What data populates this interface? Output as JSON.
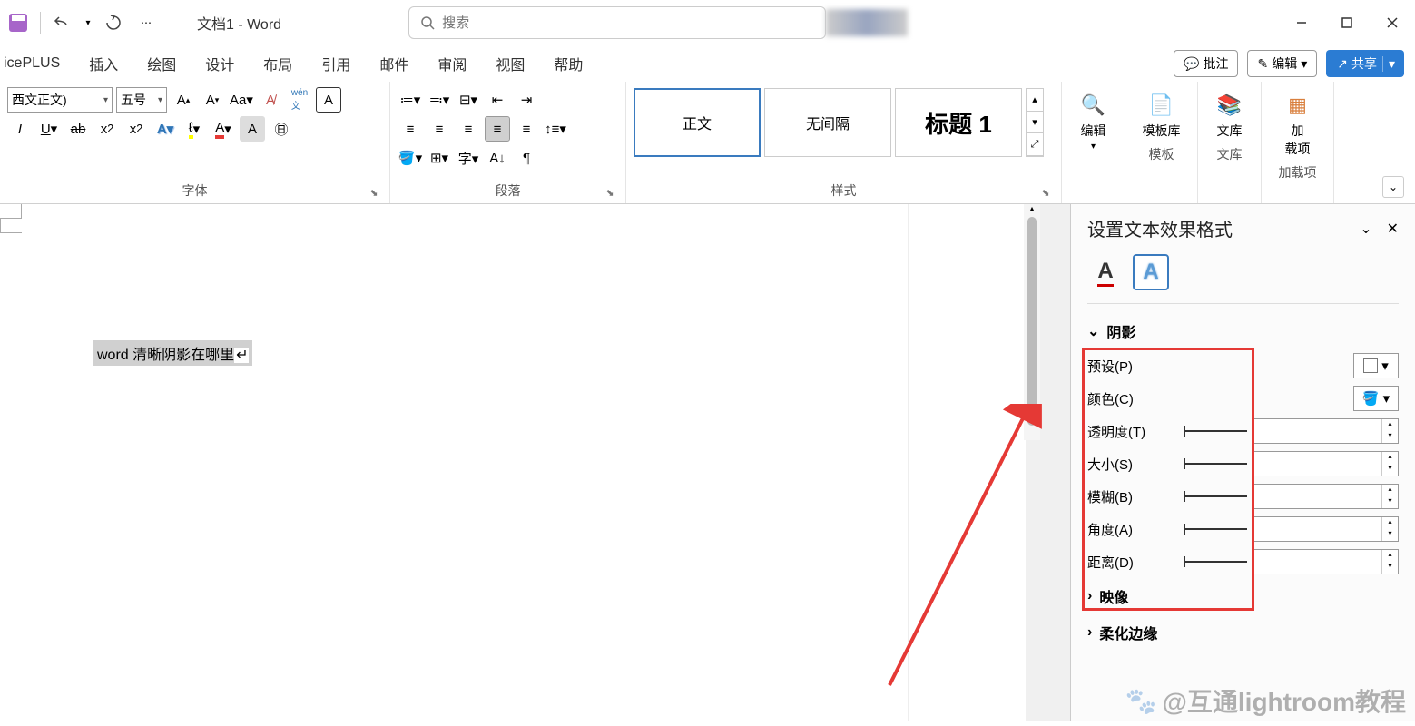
{
  "titlebar": {
    "doc_title": "文档1  -  Word",
    "search_placeholder": "搜索"
  },
  "tabs": {
    "iceplus": "icePLUS",
    "insert": "插入",
    "draw": "绘图",
    "design": "设计",
    "layout": "布局",
    "references": "引用",
    "mail": "邮件",
    "review": "审阅",
    "view": "视图",
    "help": "帮助"
  },
  "ribbon_right": {
    "comments": "批注",
    "editing": "编辑",
    "share": "共享"
  },
  "font_group": {
    "label": "字体",
    "font_combo": "西文正文)",
    "size_combo": "五号"
  },
  "para_group": {
    "label": "段落"
  },
  "styles_group": {
    "label": "样式",
    "normal": "正文",
    "nospacing": "无间隔",
    "heading1": "标题 1"
  },
  "editing_group": {
    "label": "编辑"
  },
  "template_group": {
    "label": "模板",
    "lib": "模板库"
  },
  "wenku_group": {
    "label": "文库",
    "btn": "文库"
  },
  "addin_group": {
    "label": "加载项",
    "btn": "加\n载项"
  },
  "document": {
    "text": "word 清晰阴影在哪里"
  },
  "format_pane": {
    "title": "设置文本效果格式",
    "shadow_section": "阴影",
    "preset": "预设(P)",
    "color": "颜色(C)",
    "transparency": "透明度(T)",
    "size": "大小(S)",
    "blur": "模糊(B)",
    "angle": "角度(A)",
    "distance": "距离(D)",
    "reflection": "映像",
    "glow": "柔化边缘"
  },
  "watermark": "@互通lightroom教程"
}
